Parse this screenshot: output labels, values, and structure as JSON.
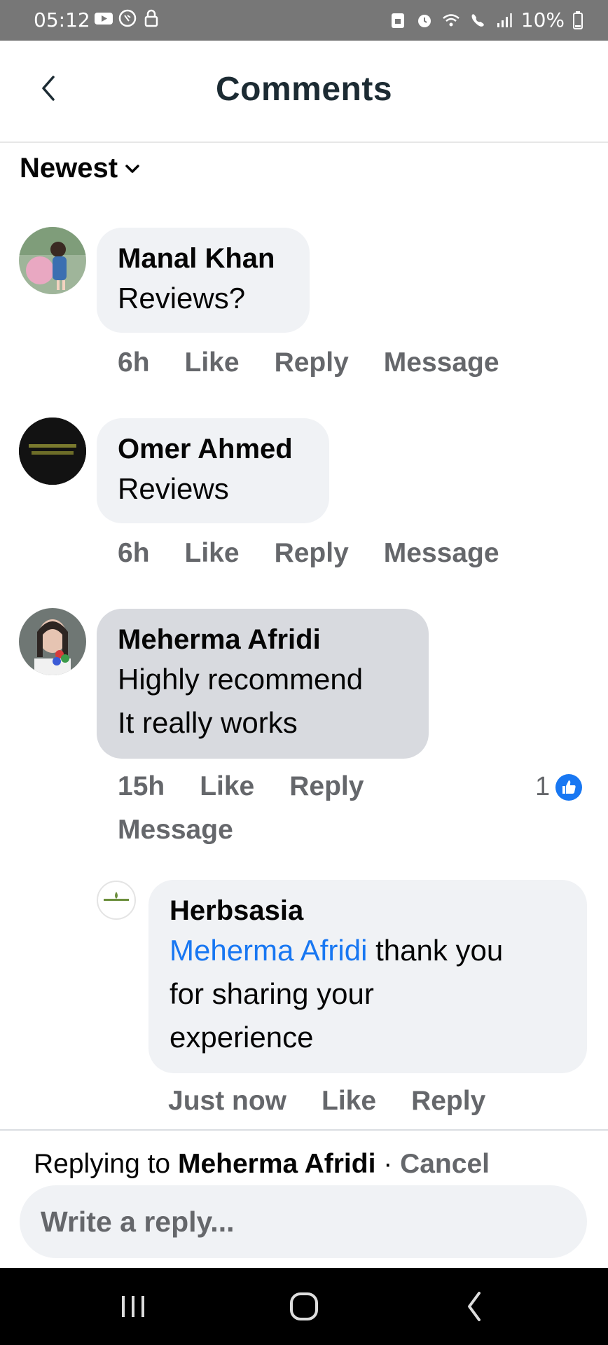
{
  "status_bar": {
    "time": "05:12",
    "battery": "10%"
  },
  "header": {
    "title": "Comments"
  },
  "sort": {
    "label": "Newest"
  },
  "comments": [
    {
      "author": "Manal Khan",
      "lines": [
        "Reviews?"
      ],
      "time": "6h",
      "like": "Like",
      "reply": "Reply",
      "message": "Message"
    },
    {
      "author": "Omer Ahmed",
      "lines": [
        "Reviews"
      ],
      "time": "6h",
      "like": "Like",
      "reply": "Reply",
      "message": "Message"
    },
    {
      "author": "Meherma Afridi",
      "lines": [
        "Highly recommend",
        "It really works"
      ],
      "time": "15h",
      "like": "Like",
      "reply": "Reply",
      "message": "Message",
      "reaction_count": "1"
    }
  ],
  "reply": {
    "author": "Herbsasia",
    "mention": "Meherma Afridi",
    "text_line1": " thank you",
    "text_line2": "for sharing your",
    "text_line3": "experience",
    "time": "Just now",
    "like": "Like",
    "reply": "Reply"
  },
  "reply_bar": {
    "prefix": "Replying to ",
    "target": "Meherma Afridi",
    "separator": " · ",
    "cancel": "Cancel",
    "placeholder": "Write a reply..."
  },
  "colors": {
    "accent": "#1877f2",
    "status_bar": "#777777",
    "bubble": "#f0f2f5",
    "bubble_highlight": "#d8dadf"
  }
}
